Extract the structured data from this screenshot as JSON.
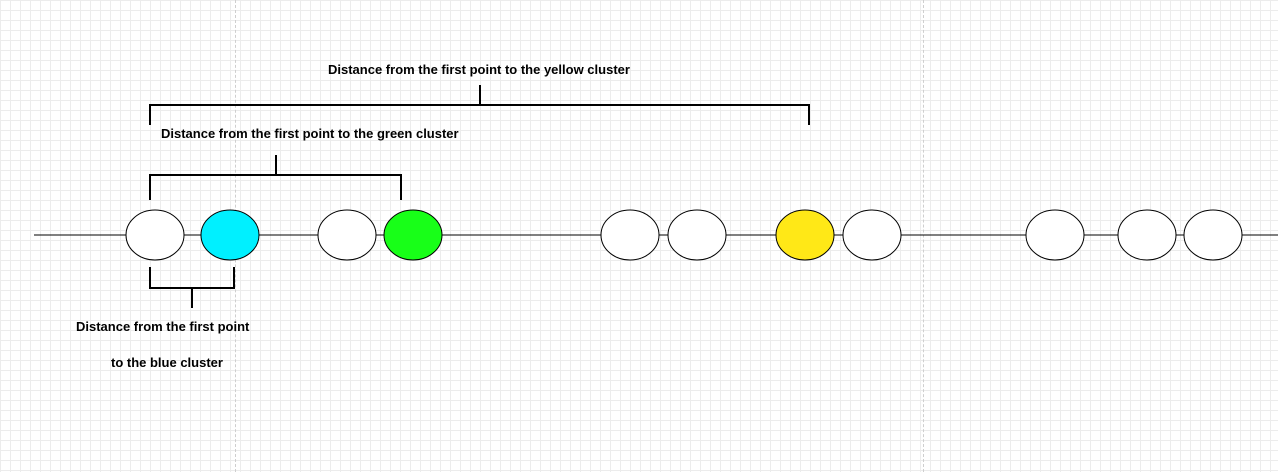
{
  "labels": {
    "yellow_distance": "Distance from the first point to the yellow cluster",
    "green_distance": "Distance from the first point to the green cluster",
    "blue_distance_line1": "Distance from the first point",
    "blue_distance_line2": "to the blue cluster"
  },
  "colors": {
    "blue_cluster": "#00f0ff",
    "green_cluster": "#18ff18",
    "yellow_cluster": "#ffe817",
    "plain_point": "#ffffff",
    "stroke": "#000000"
  },
  "points": [
    {
      "name": "point-1",
      "fill": "plain"
    },
    {
      "name": "point-2-blue-cluster",
      "fill": "blue"
    },
    {
      "name": "point-3",
      "fill": "plain"
    },
    {
      "name": "point-4-green-cluster",
      "fill": "green"
    },
    {
      "name": "point-5",
      "fill": "plain"
    },
    {
      "name": "point-6",
      "fill": "plain"
    },
    {
      "name": "point-7-yellow-cluster",
      "fill": "yellow"
    },
    {
      "name": "point-8",
      "fill": "plain"
    },
    {
      "name": "point-9",
      "fill": "plain"
    },
    {
      "name": "point-10",
      "fill": "plain"
    },
    {
      "name": "point-11",
      "fill": "plain"
    }
  ]
}
